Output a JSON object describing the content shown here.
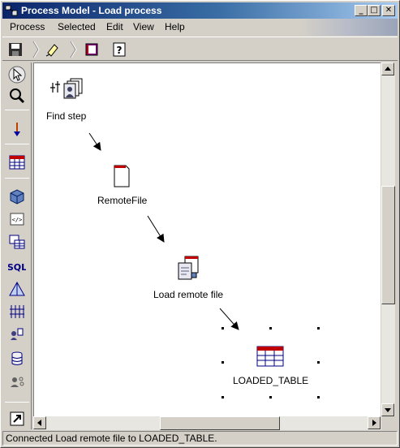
{
  "window": {
    "title": "Process Model - Load process",
    "buttons": {
      "minimize": "_",
      "maximize": "□",
      "close": "✕"
    }
  },
  "menu": {
    "items": [
      "Process",
      "Selected",
      "Edit",
      "View",
      "Help"
    ]
  },
  "toolbar": {
    "icons": [
      "save-icon",
      "highlighter-icon",
      "book-icon",
      "help-icon"
    ]
  },
  "palette": {
    "icons": [
      "pointer-icon",
      "zoom-icon",
      "link-arrow-icon",
      "source-table-icon",
      "cube-icon",
      "program-icon",
      "tables-icon",
      "sql-icon",
      "transform-icon",
      "grid-icon",
      "user-program-icon",
      "database-icon",
      "user-step-icon",
      "shortcut-icon"
    ],
    "sql_label": "SQL"
  },
  "canvas": {
    "nodes": [
      {
        "name": "find-step",
        "label": "Find step"
      },
      {
        "name": "remote-file",
        "label": "RemoteFile"
      },
      {
        "name": "load-remote-file",
        "label": "Load remote file"
      },
      {
        "name": "loaded-table",
        "label": "LOADED_TABLE",
        "selected": true
      }
    ]
  },
  "status": {
    "text": "Connected Load remote file to LOADED_TABLE."
  },
  "colors": {
    "title_start": "#0a246a",
    "title_end": "#a6caf0",
    "face": "#d4d0c8",
    "canvas": "#ffffff"
  }
}
